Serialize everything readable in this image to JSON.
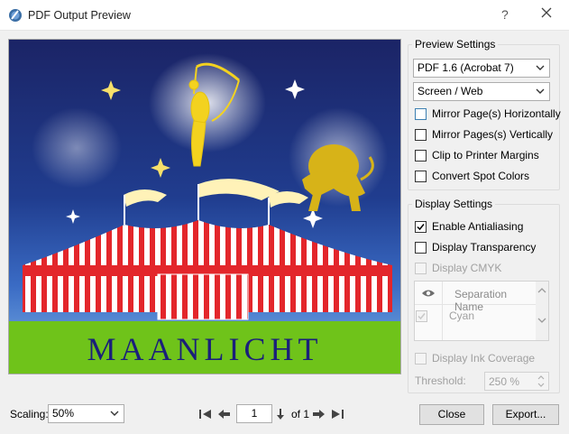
{
  "window": {
    "title": "PDF Output Preview",
    "help_label": "?"
  },
  "preview": {
    "banner_text": "MAANLICHT"
  },
  "preview_settings": {
    "title": "Preview Settings",
    "pdf_version": "PDF 1.6 (Acrobat 7)",
    "output_profile": "Screen / Web",
    "options": [
      {
        "label": "Mirror Page(s) Horizontally",
        "checked": false
      },
      {
        "label": "Mirror Pages(s) Vertically",
        "checked": false
      },
      {
        "label": "Clip to Printer Margins",
        "checked": false
      },
      {
        "label": "Convert Spot Colors",
        "checked": false
      }
    ]
  },
  "display_settings": {
    "title": "Display Settings",
    "options": [
      {
        "label": "Enable Antialiasing",
        "checked": true,
        "enabled": true
      },
      {
        "label": "Display Transparency",
        "checked": false,
        "enabled": true
      },
      {
        "label": "Display CMYK",
        "checked": false,
        "enabled": false
      }
    ],
    "separation_table": {
      "column_header": "Separation Name",
      "rows": [
        {
          "name": "Cyan",
          "visible": true
        }
      ]
    },
    "ink_coverage_label": "Display Ink Coverage",
    "threshold_label": "Threshold:",
    "threshold_value": "250 %"
  },
  "footer": {
    "scaling_label": "Scaling:",
    "scaling_value": "50%",
    "page_value": "1",
    "page_of_label": "of 1",
    "close_label": "Close",
    "export_label": "Export..."
  },
  "colors": {
    "sky_top": "#1a2a6c",
    "grass": "#6fc31a",
    "gold": "#d7b318",
    "tent_red": "#e3262b",
    "accent_blue": "#3c7fb1"
  }
}
